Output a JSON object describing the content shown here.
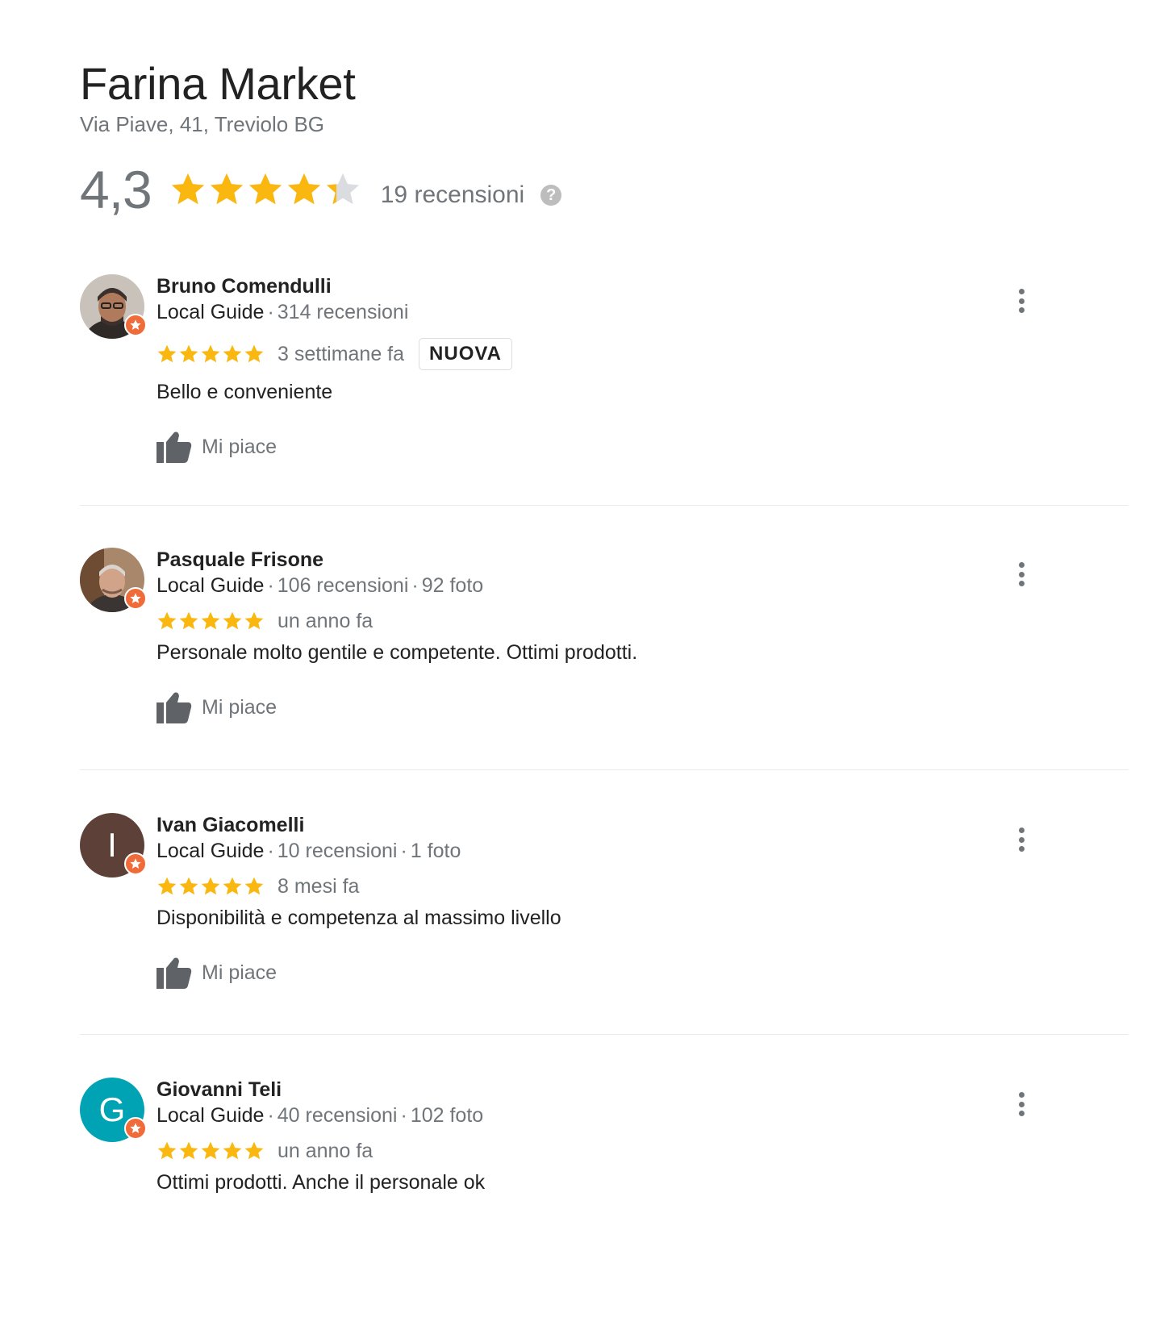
{
  "place": {
    "name": "Farina Market",
    "address": "Via Piave, 41, Treviolo BG",
    "rating": "4,3",
    "rating_value": 4.3,
    "reviews_count": "19 recensioni",
    "help_icon_glyph": "?"
  },
  "colors": {
    "star": "#f9b70f",
    "star_empty": "#dadce0",
    "badge": "#ef6c3a",
    "muted": "#70757a"
  },
  "reviews": [
    {
      "name": "Bruno Comendulli",
      "local_guide": "Local Guide",
      "stats": "314 recensioni",
      "stars": 5,
      "time": "3 settimane fa",
      "new_label": "NUOVA",
      "text": "Bello e conveniente",
      "like_label": "Mi piace",
      "avatar_color": "#6d5a4f"
    },
    {
      "name": "Pasquale Frisone",
      "local_guide": "Local Guide",
      "stats": "106 recensioni",
      "stats2": "92 foto",
      "stars": 5,
      "time": "un anno fa",
      "text": "Personale molto gentile e competente. Ottimi prodotti.",
      "like_label": "Mi piace",
      "avatar_color": "#8a6a52"
    },
    {
      "name": "Ivan Giacomelli",
      "local_guide": "Local Guide",
      "stats": "10 recensioni",
      "stats2": "1 foto",
      "stars": 5,
      "time": "8 mesi fa",
      "text": "Disponibilità e competenza al massimo livello",
      "like_label": "Mi piace",
      "avatar_letter": "I",
      "avatar_color": "#5d4037"
    },
    {
      "name": "Giovanni Teli",
      "local_guide": "Local Guide",
      "stats": "40 recensioni",
      "stats2": "102 foto",
      "stars": 5,
      "time": "un anno fa",
      "text": "Ottimi prodotti. Anche il personale ok",
      "avatar_letter": "G",
      "avatar_color": "#00a3b4"
    }
  ],
  "separator": "·"
}
